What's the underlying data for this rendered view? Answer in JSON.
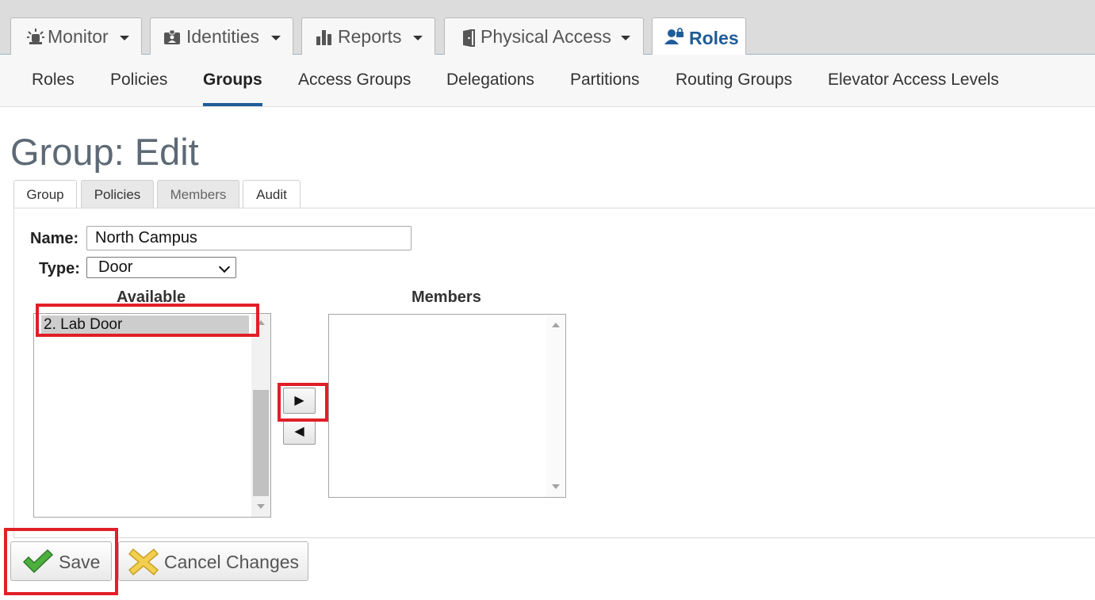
{
  "top_tabs": [
    {
      "label": "Monitor",
      "icon": "alarm-icon"
    },
    {
      "label": "Identities",
      "icon": "id-badge-icon"
    },
    {
      "label": "Reports",
      "icon": "bar-chart-icon"
    },
    {
      "label": "Physical Access",
      "icon": "door-icon"
    },
    {
      "label": "Roles",
      "icon": "user-lock-icon",
      "active": true
    }
  ],
  "sub_nav": [
    "Roles",
    "Policies",
    "Groups",
    "Access Groups",
    "Delegations",
    "Partitions",
    "Routing Groups",
    "Elevator Access Levels"
  ],
  "sub_nav_active": "Groups",
  "page_title": "Group: Edit",
  "inner_tabs": [
    "Group",
    "Policies",
    "Members",
    "Audit"
  ],
  "form": {
    "name_label": "Name:",
    "name_value": "North Campus",
    "type_label": "Type:",
    "type_value": "Door"
  },
  "available": {
    "header": "Available",
    "items": [
      "2. Lab Door"
    ]
  },
  "members": {
    "header": "Members",
    "items": []
  },
  "move_buttons": {
    "add": "▶",
    "remove": "◀"
  },
  "buttons": {
    "save": "Save",
    "cancel": "Cancel Changes"
  },
  "colors": {
    "accent": "#1f5c99",
    "highlight": "#e01f26"
  }
}
